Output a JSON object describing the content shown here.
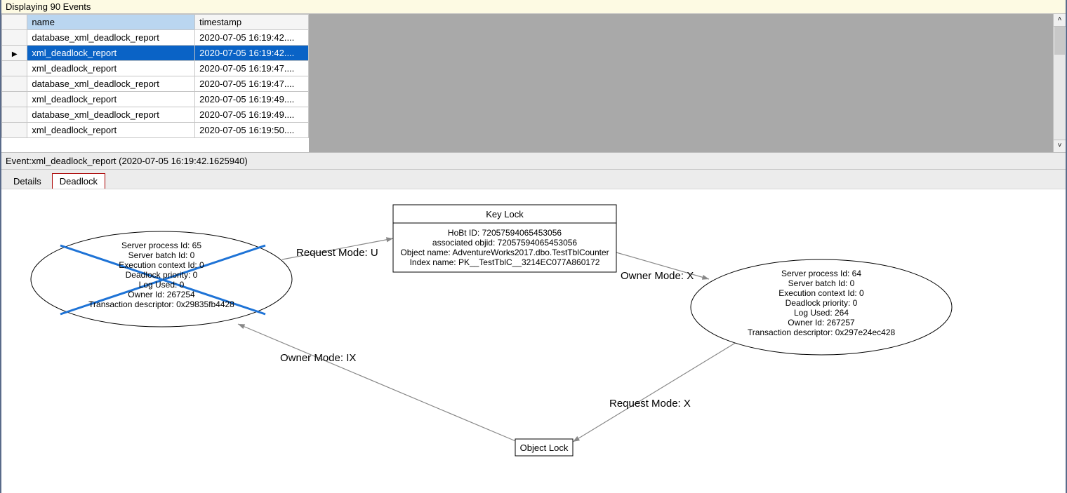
{
  "status_label": "Displaying 90 Events",
  "grid": {
    "headers": {
      "name": "name",
      "timestamp": "timestamp"
    },
    "rows": [
      {
        "name": "database_xml_deadlock_report",
        "timestamp": "2020-07-05 16:19:42....",
        "selected": false,
        "indicator": ""
      },
      {
        "name": "xml_deadlock_report",
        "timestamp": "2020-07-05 16:19:42....",
        "selected": true,
        "indicator": "▶"
      },
      {
        "name": "xml_deadlock_report",
        "timestamp": "2020-07-05 16:19:47....",
        "selected": false,
        "indicator": ""
      },
      {
        "name": "database_xml_deadlock_report",
        "timestamp": "2020-07-05 16:19:47....",
        "selected": false,
        "indicator": ""
      },
      {
        "name": "xml_deadlock_report",
        "timestamp": "2020-07-05 16:19:49....",
        "selected": false,
        "indicator": ""
      },
      {
        "name": "database_xml_deadlock_report",
        "timestamp": "2020-07-05 16:19:49....",
        "selected": false,
        "indicator": ""
      },
      {
        "name": "xml_deadlock_report",
        "timestamp": "2020-07-05 16:19:50....",
        "selected": false,
        "indicator": ""
      }
    ]
  },
  "event_line": "Event:xml_deadlock_report (2020-07-05 16:19:42.1625940)",
  "tabs": {
    "details": "Details",
    "deadlock": "Deadlock",
    "active": "deadlock"
  },
  "graph": {
    "victim": {
      "lines": [
        "Server process Id: 65",
        "Server batch Id: 0",
        "Execution context Id: 0",
        "Deadlock priority: 0",
        "Log Used: 0",
        "Owner Id: 267254",
        "Transaction descriptor: 0x29835fb4428"
      ]
    },
    "survivor": {
      "lines": [
        "Server process Id: 64",
        "Server batch Id: 0",
        "Execution context Id: 0",
        "Deadlock priority: 0",
        "Log Used: 264",
        "Owner Id: 267257",
        "Transaction descriptor: 0x297e24ec428"
      ]
    },
    "key_lock": {
      "title": "Key Lock",
      "lines": [
        "HoBt ID: 72057594065453056",
        "associated objid: 72057594065453056",
        "Object name: AdventureWorks2017.dbo.TestTblCounter",
        "Index name: PK__TestTblC__3214EC077A860172"
      ]
    },
    "object_lock": {
      "title": "Object Lock"
    },
    "edges": {
      "req_u": "Request Mode: U",
      "own_x": "Owner Mode: X",
      "own_ix": "Owner Mode: IX",
      "req_x": "Request Mode: X"
    }
  }
}
